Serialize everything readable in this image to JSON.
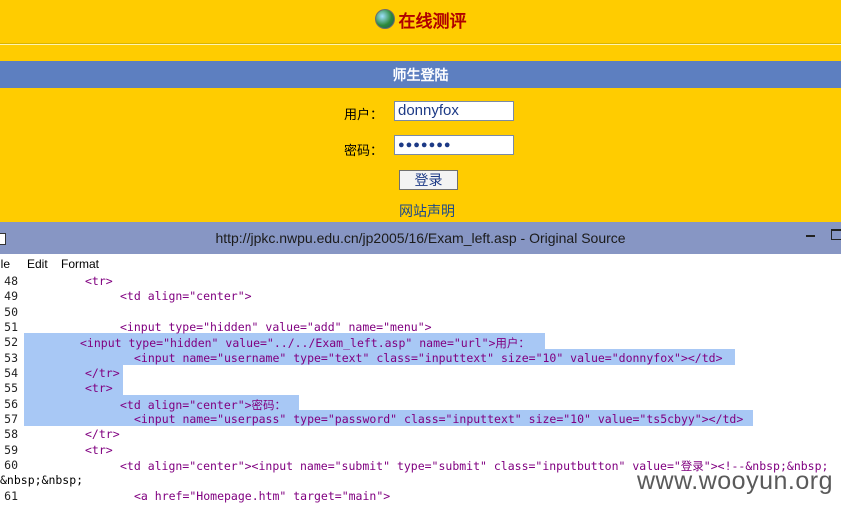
{
  "page": {
    "title": "在线测评",
    "login_bar": "师生登陆",
    "username_label": "用户：",
    "username_value": "donnyfox",
    "password_label": "密码：",
    "password_mask": "●●●●●●●",
    "login_button": "登录",
    "notice_link": "网站声明"
  },
  "window": {
    "title": "http://jpkc.nwpu.edu.cn/jp2005/16/Exam_left.asp - Original Source",
    "menu": [
      "ile",
      "Edit",
      "Format"
    ]
  },
  "source": {
    "line_numbers": [
      "48",
      "49",
      "50",
      "51",
      "52",
      "53",
      "54",
      "55",
      "56",
      "57",
      "58",
      "59",
      "60",
      "",
      "61"
    ],
    "lines": [
      "<tr>",
      "<td align=\"center\">",
      "",
      "<input type=\"hidden\" value=\"add\" name=\"menu\">",
      "<input type=\"hidden\" value=\"../../Exam_left.asp\" name=\"url\">用户：",
      "<input name=\"username\" type=\"text\" class=\"inputtext\" size=\"10\" value=\"donnyfox\"></td>",
      "</tr>",
      "<tr>",
      "<td align=\"center\">密码：",
      "<input name=\"userpass\" type=\"password\" class=\"inputtext\" size=\"10\" value=\"ts5cbyy\"></td>",
      "</tr>",
      "<tr>",
      "<td align=\"center\"><input name=\"submit\" type=\"submit\" class=\"inputbutton\" value=\"登录\"><!--&nbsp;&nbsp;",
      "&nbsp;&nbsp;",
      "<a href=\"Homepage.htm\" target=\"main\">"
    ]
  },
  "watermark": "www.wooyun.org",
  "colors": {
    "page_bg": "#ffcc00",
    "bar_bg": "#5d7fc0",
    "titlebar_bg": "#8796c4",
    "highlight": "#a8c8f5"
  }
}
